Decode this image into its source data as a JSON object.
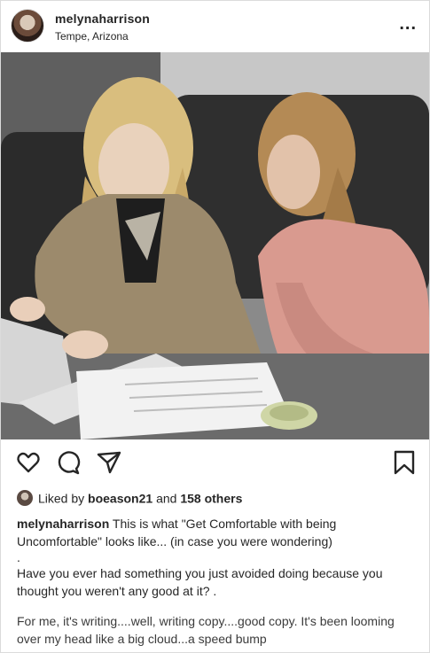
{
  "post": {
    "username": "melynaharrison",
    "location": "Tempe, Arizona",
    "more_label": "..."
  },
  "icons": {
    "like": "heart-icon",
    "comment": "comment-icon",
    "share": "send-icon",
    "save": "bookmark-icon"
  },
  "likes": {
    "prefix": "Liked by",
    "user": "boeason21",
    "and": "and",
    "others": "158 others"
  },
  "caption": {
    "username": "melynaharrison",
    "line1": "This is what \"Get Comfortable with being Uncomfortable\" looks like... (in case you were wondering)",
    "line2": ".",
    "line3": "Have you ever had something you just avoided doing because you thought you weren't any good at it? .",
    "line4": "For me, it's writing....well, writing copy....good copy. It's been looming over my head like a big cloud...a speed bump"
  },
  "colors": {
    "text": "#262626",
    "border": "#dbdbdb"
  }
}
